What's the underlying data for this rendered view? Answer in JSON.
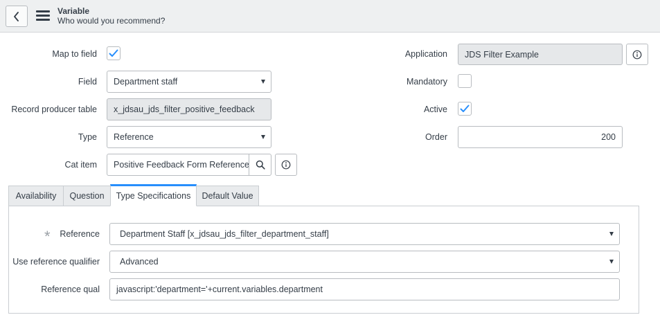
{
  "header": {
    "title": "Variable",
    "subtitle": "Who would you recommend?"
  },
  "form": {
    "map_to_field": {
      "label": "Map to field",
      "checked": true
    },
    "field": {
      "label": "Field",
      "value": "Department staff"
    },
    "record_producer_table": {
      "label": "Record producer table",
      "value": "x_jdsau_jds_filter_positive_feedback"
    },
    "type": {
      "label": "Type",
      "value": "Reference"
    },
    "cat_item": {
      "label": "Cat item",
      "value": "Positive Feedback Form Reference"
    },
    "application": {
      "label": "Application",
      "value": "JDS Filter Example"
    },
    "mandatory": {
      "label": "Mandatory",
      "checked": false
    },
    "active": {
      "label": "Active",
      "checked": true
    },
    "order": {
      "label": "Order",
      "value": "200"
    }
  },
  "tabs": [
    {
      "label": "Availability",
      "active": false
    },
    {
      "label": "Question",
      "active": false
    },
    {
      "label": "Type Specifications",
      "active": true
    },
    {
      "label": "Default Value",
      "active": false
    }
  ],
  "type_specifications": {
    "reference": {
      "label": "Reference",
      "value": "Department Staff [x_jdsau_jds_filter_department_staff]",
      "required": true
    },
    "use_reference_qualifier": {
      "label": "Use reference qualifier",
      "value": "Advanced"
    },
    "reference_qual": {
      "label": "Reference qual",
      "value": "javascript:'department='+current.variables.department"
    }
  },
  "colors": {
    "accent": "#278efc",
    "header_bg": "#eef0f1",
    "readonly_bg": "#e6e8ea",
    "checkmark": "#278efc"
  }
}
